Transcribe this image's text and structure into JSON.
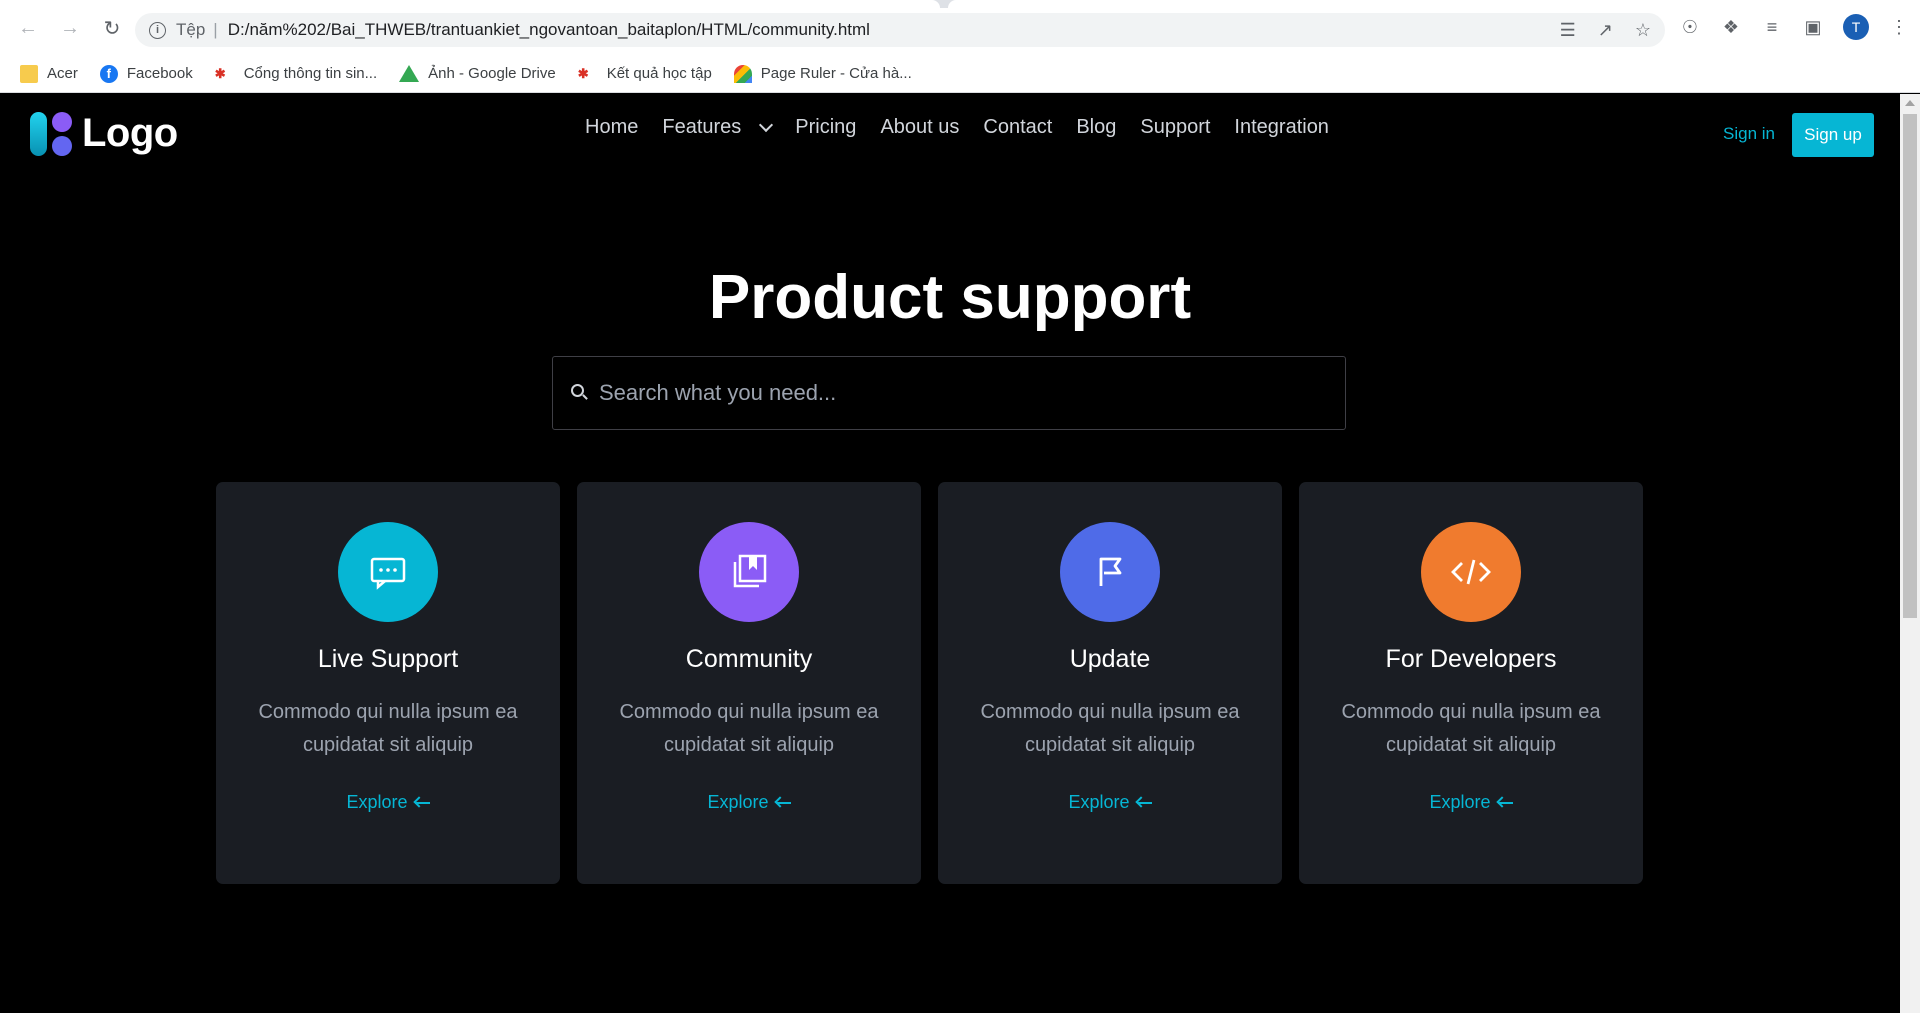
{
  "browser": {
    "url_scheme": "Tệp",
    "url": "D:/năm%202/Bai_THWEB/trantuankiet_ngovantoan_baitaplon/HTML/community.html",
    "avatar_letter": "T",
    "bookmarks": [
      {
        "label": "Acer",
        "icon": "folder-icon"
      },
      {
        "label": "Facebook",
        "icon": "facebook-icon"
      },
      {
        "label": "Cổng thông tin sin...",
        "icon": "school-icon"
      },
      {
        "label": "Ảnh - Google Drive",
        "icon": "google-drive-icon"
      },
      {
        "label": "Kết quả học tập",
        "icon": "school-icon"
      },
      {
        "label": "Page Ruler - Cửa hà...",
        "icon": "page-ruler-icon"
      }
    ]
  },
  "header": {
    "logo_text": "Logo",
    "nav": [
      "Home",
      "Features",
      "Pricing",
      "About us",
      "Contact",
      "Blog",
      "Support",
      "Integration"
    ],
    "sign_in": "Sign in",
    "sign_up": "Sign up"
  },
  "hero": {
    "title": "Product support",
    "search_placeholder": "Search what you need..."
  },
  "cards": [
    {
      "title": "Live Support",
      "desc": "Commodo qui nulla ipsum ea cupidatat sit aliquip",
      "link": "Explore",
      "color": "#06b6d4",
      "icon": "chat-icon"
    },
    {
      "title": "Community",
      "desc": "Commodo qui nulla ipsum ea cupidatat sit aliquip",
      "link": "Explore",
      "color": "#8b5cf6",
      "icon": "bookmarks-icon"
    },
    {
      "title": "Update",
      "desc": "Commodo qui nulla ipsum ea cupidatat sit aliquip",
      "link": "Explore",
      "color": "#4f6be8",
      "icon": "flag-icon"
    },
    {
      "title": "For Developers",
      "desc": "Commodo qui nulla ipsum ea cupidatat sit aliquip",
      "link": "Explore",
      "color": "#f07b2e",
      "icon": "code-icon"
    }
  ],
  "colors": {
    "accent": "#06b6d4",
    "card_bg": "#1a1d23",
    "page_bg": "#000000"
  }
}
